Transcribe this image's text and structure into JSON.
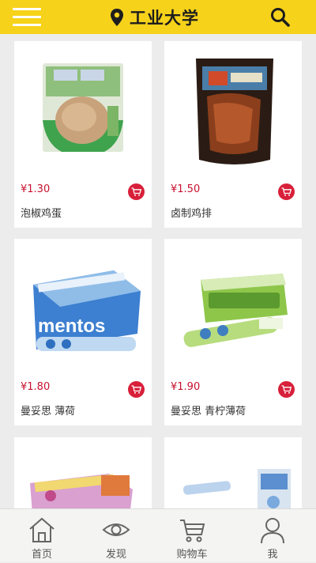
{
  "header": {
    "location": "工业大学",
    "accent_color": "#f7d21a",
    "icons": {
      "menu": "menu-icon",
      "location": "location-pin-icon",
      "search": "search-icon"
    }
  },
  "products": [
    {
      "price": "¥1.30",
      "name": "泡椒鸡蛋"
    },
    {
      "price": "¥1.50",
      "name": "卤制鸡排"
    },
    {
      "price": "¥1.80",
      "name": "曼妥思 薄荷"
    },
    {
      "price": "¥1.90",
      "name": "曼妥思 青柠薄荷"
    },
    {
      "price": "",
      "name": ""
    },
    {
      "price": "",
      "name": ""
    }
  ],
  "product_icon": "cart-icon",
  "price_color": "#c8102e",
  "bottom_nav": [
    {
      "label": "首页",
      "icon": "home-icon"
    },
    {
      "label": "发现",
      "icon": "eye-icon"
    },
    {
      "label": "购物车",
      "icon": "shopping-cart-icon"
    },
    {
      "label": "我",
      "icon": "user-icon"
    }
  ]
}
